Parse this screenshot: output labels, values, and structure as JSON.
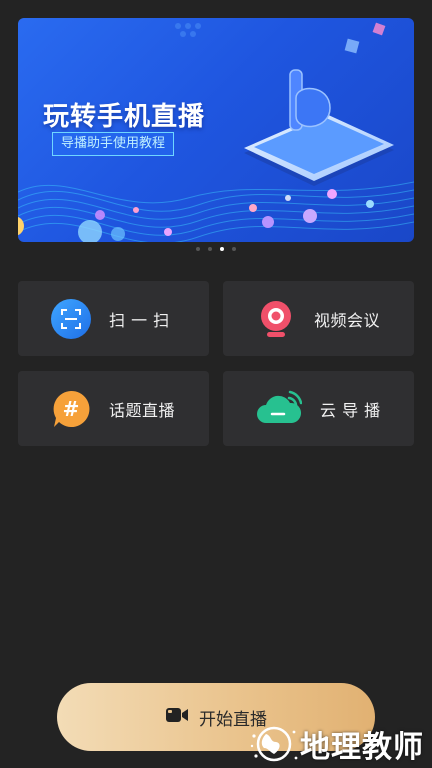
{
  "banner": {
    "title": "玩转手机直播",
    "subtitle": "导播助手使用教程"
  },
  "carousel": {
    "count": 4,
    "active_index": 2
  },
  "tiles": [
    {
      "label": "扫 一 扫",
      "icon": "scan-icon",
      "color": "#2f8df5"
    },
    {
      "label": "视频会议",
      "icon": "webcam-icon",
      "color": "#f0506a"
    },
    {
      "label": "话题直播",
      "icon": "hashtag-chat-icon",
      "color": "#f6a13a"
    },
    {
      "label": "云 导 播",
      "icon": "cloud-wifi-icon",
      "color": "#27c190"
    }
  ],
  "start_button": {
    "label": "开始直播",
    "icon": "video-camera-icon"
  },
  "watermark": {
    "text": "地理教师"
  },
  "colors": {
    "background": "#232323",
    "tile": "#2f2f31",
    "banner": "#2162e8",
    "button_gradient_start": "#f3dcb6",
    "button_gradient_end": "#e1b172"
  }
}
